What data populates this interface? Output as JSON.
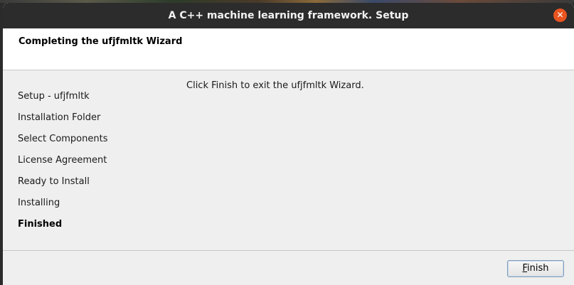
{
  "window": {
    "title": "A C++ machine learning framework. Setup"
  },
  "header": {
    "heading": "Completing the ufjfmltk Wizard"
  },
  "sidebar": {
    "steps": [
      {
        "label": "Setup - ufjfmltk",
        "current": false
      },
      {
        "label": "Installation Folder",
        "current": false
      },
      {
        "label": "Select Components",
        "current": false
      },
      {
        "label": "License Agreement",
        "current": false
      },
      {
        "label": "Ready to Install",
        "current": false
      },
      {
        "label": "Installing",
        "current": false
      },
      {
        "label": "Finished",
        "current": true
      }
    ]
  },
  "content": {
    "message": "Click Finish to exit the ufjfmltk Wizard."
  },
  "footer": {
    "finish_mnemonic": "F",
    "finish_rest": "inish"
  },
  "colors": {
    "titlebar": "#2c2c2c",
    "close_button": "#e95420",
    "window_bg": "#efefef"
  }
}
